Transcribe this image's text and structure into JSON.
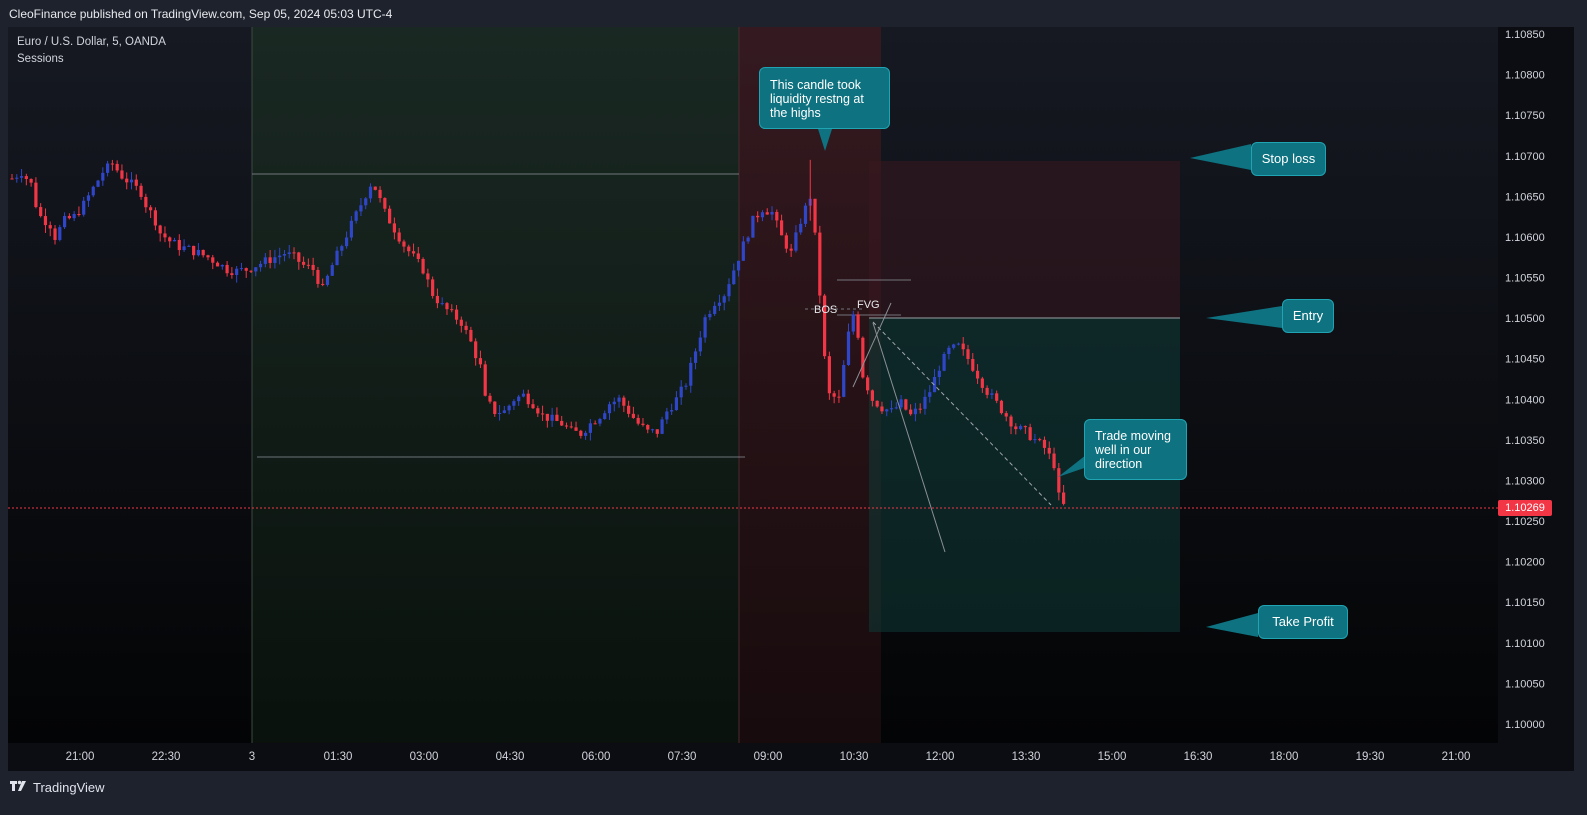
{
  "header": {
    "text": "CleoFinance published on TradingView.com, Sep 05, 2024 05:03 UTC-4"
  },
  "legend": {
    "symbol": "Euro / U.S. Dollar, 5, OANDA",
    "indicator": "Sessions"
  },
  "footer": {
    "logo_text": "TradingView"
  },
  "annotations": {
    "liquidity": "This candle took liquidity restng at the highs",
    "stop_loss": "Stop loss",
    "entry": "Entry",
    "take_profit": "Take Profit",
    "trade_moving": "Trade moving well in our direction",
    "bos": "BOS",
    "fvg": "FVG"
  },
  "colors": {
    "bull": "#2f46c9",
    "bear": "#f23645",
    "callout_bg": "#0e7280",
    "session_asia": "#182520",
    "session_london": "#2a1216",
    "stop_zone": "#2b141a",
    "target_zone": "#0b2a28"
  },
  "chart_data": {
    "type": "candlestick",
    "symbol": "EURUSD",
    "timeframe": "5",
    "ylim": [
      1.0998,
      1.1087
    ],
    "y_ticks": [
      "1.10850",
      "1.10800",
      "1.10750",
      "1.10700",
      "1.10650",
      "1.10600",
      "1.10550",
      "1.10500",
      "1.10450",
      "1.10400",
      "1.10350",
      "1.10300",
      "1.10250",
      "1.10200",
      "1.10150",
      "1.10100",
      "1.10050",
      "1.10000"
    ],
    "x_ticks": [
      "21:00",
      "22:30",
      "3",
      "01:30",
      "03:00",
      "04:30",
      "06:00",
      "07:30",
      "09:00",
      "10:30",
      "12:00",
      "13:30",
      "15:00",
      "16:30",
      "18:00",
      "19:30",
      "21:00"
    ],
    "last_price": "1.10269",
    "levels": {
      "stop_loss": 1.10695,
      "entry": 1.105,
      "take_profit": 1.10115,
      "range_high": 1.1068,
      "range_low": 1.10333,
      "fvg_high": 1.10547,
      "fvg_low": 1.10504
    },
    "close_path": [
      [
        0,
        1.10672
      ],
      [
        2,
        1.1068
      ],
      [
        4,
        1.10665
      ],
      [
        5,
        1.1064
      ],
      [
        6,
        1.10625
      ],
      [
        8,
        1.10615
      ],
      [
        9,
        1.106
      ],
      [
        11,
        1.1062
      ],
      [
        13,
        1.10625
      ],
      [
        15,
        1.1064
      ],
      [
        17,
        1.1066
      ],
      [
        19,
        1.1068
      ],
      [
        21,
        1.1069
      ],
      [
        23,
        1.10675
      ],
      [
        25,
        1.10665
      ],
      [
        27,
        1.10655
      ],
      [
        28,
        1.1064
      ],
      [
        30,
        1.1062
      ],
      [
        31,
        1.10605
      ],
      [
        33,
        1.10595
      ],
      [
        35,
        1.10588
      ],
      [
        37,
        1.10585
      ],
      [
        39,
        1.1058
      ],
      [
        41,
        1.10575
      ],
      [
        43,
        1.10568
      ],
      [
        45,
        1.1056
      ],
      [
        47,
        1.10558
      ],
      [
        49,
        1.1056
      ],
      [
        51,
        1.10565
      ],
      [
        53,
        1.1057
      ],
      [
        55,
        1.10575
      ],
      [
        57,
        1.1058
      ],
      [
        59,
        1.10575
      ],
      [
        61,
        1.10565
      ],
      [
        63,
        1.1056
      ],
      [
        65,
        1.10535
      ],
      [
        67,
        1.10565
      ],
      [
        69,
        1.1059
      ],
      [
        71,
        1.10615
      ],
      [
        73,
        1.1064
      ],
      [
        75,
        1.10665
      ],
      [
        76,
        1.1066
      ],
      [
        78,
        1.1063
      ],
      [
        80,
        1.1061
      ],
      [
        82,
        1.1059
      ],
      [
        84,
        1.10575
      ],
      [
        86,
        1.1056
      ],
      [
        88,
        1.1053
      ],
      [
        90,
        1.10515
      ],
      [
        92,
        1.10505
      ],
      [
        94,
        1.10495
      ],
      [
        96,
        1.1047
      ],
      [
        98,
        1.1044
      ],
      [
        99,
        1.104
      ],
      [
        101,
        1.10385
      ],
      [
        103,
        1.10385
      ],
      [
        105,
        1.104
      ],
      [
        107,
        1.10405
      ],
      [
        109,
        1.10395
      ],
      [
        111,
        1.1038
      ],
      [
        113,
        1.10375
      ],
      [
        115,
        1.1037
      ],
      [
        117,
        1.1036
      ],
      [
        119,
        1.10358
      ],
      [
        121,
        1.1037
      ],
      [
        123,
        1.1038
      ],
      [
        125,
        1.10395
      ],
      [
        127,
        1.104
      ],
      [
        129,
        1.10385
      ],
      [
        131,
        1.1037
      ],
      [
        133,
        1.1036
      ],
      [
        135,
        1.1036
      ],
      [
        137,
        1.10385
      ],
      [
        139,
        1.104
      ],
      [
        141,
        1.1042
      ],
      [
        143,
        1.1046
      ],
      [
        145,
        1.105
      ],
      [
        147,
        1.1052
      ],
      [
        149,
        1.1053
      ],
      [
        151,
        1.1056
      ],
      [
        153,
        1.1059
      ],
      [
        155,
        1.1062
      ],
      [
        157,
        1.10635
      ],
      [
        159,
        1.1063
      ],
      [
        161,
        1.106
      ],
      [
        163,
        1.1058
      ],
      [
        165,
        1.1062
      ],
      [
        167,
        1.1065
      ],
      [
        168,
        1.106
      ],
      [
        169,
        1.1053
      ],
      [
        170,
        1.1045
      ],
      [
        171,
        1.10405
      ],
      [
        173,
        1.104
      ],
      [
        175,
        1.1048
      ],
      [
        176,
        1.10505
      ],
      [
        177,
        1.1048
      ],
      [
        178,
        1.1043
      ],
      [
        180,
        1.104
      ],
      [
        182,
        1.1039
      ],
      [
        184,
        1.10385
      ],
      [
        186,
        1.10395
      ],
      [
        188,
        1.1038
      ],
      [
        190,
        1.1039
      ],
      [
        192,
        1.1041
      ],
      [
        194,
        1.1044
      ],
      [
        196,
        1.1046
      ],
      [
        198,
        1.10465
      ],
      [
        200,
        1.1045
      ],
      [
        202,
        1.1043
      ],
      [
        204,
        1.1041
      ],
      [
        206,
        1.10395
      ],
      [
        208,
        1.1038
      ],
      [
        210,
        1.10365
      ],
      [
        212,
        1.1036
      ],
      [
        214,
        1.1035
      ],
      [
        216,
        1.1034
      ],
      [
        218,
        1.1032
      ],
      [
        219,
        1.1028
      ],
      [
        220,
        1.10269
      ]
    ]
  }
}
